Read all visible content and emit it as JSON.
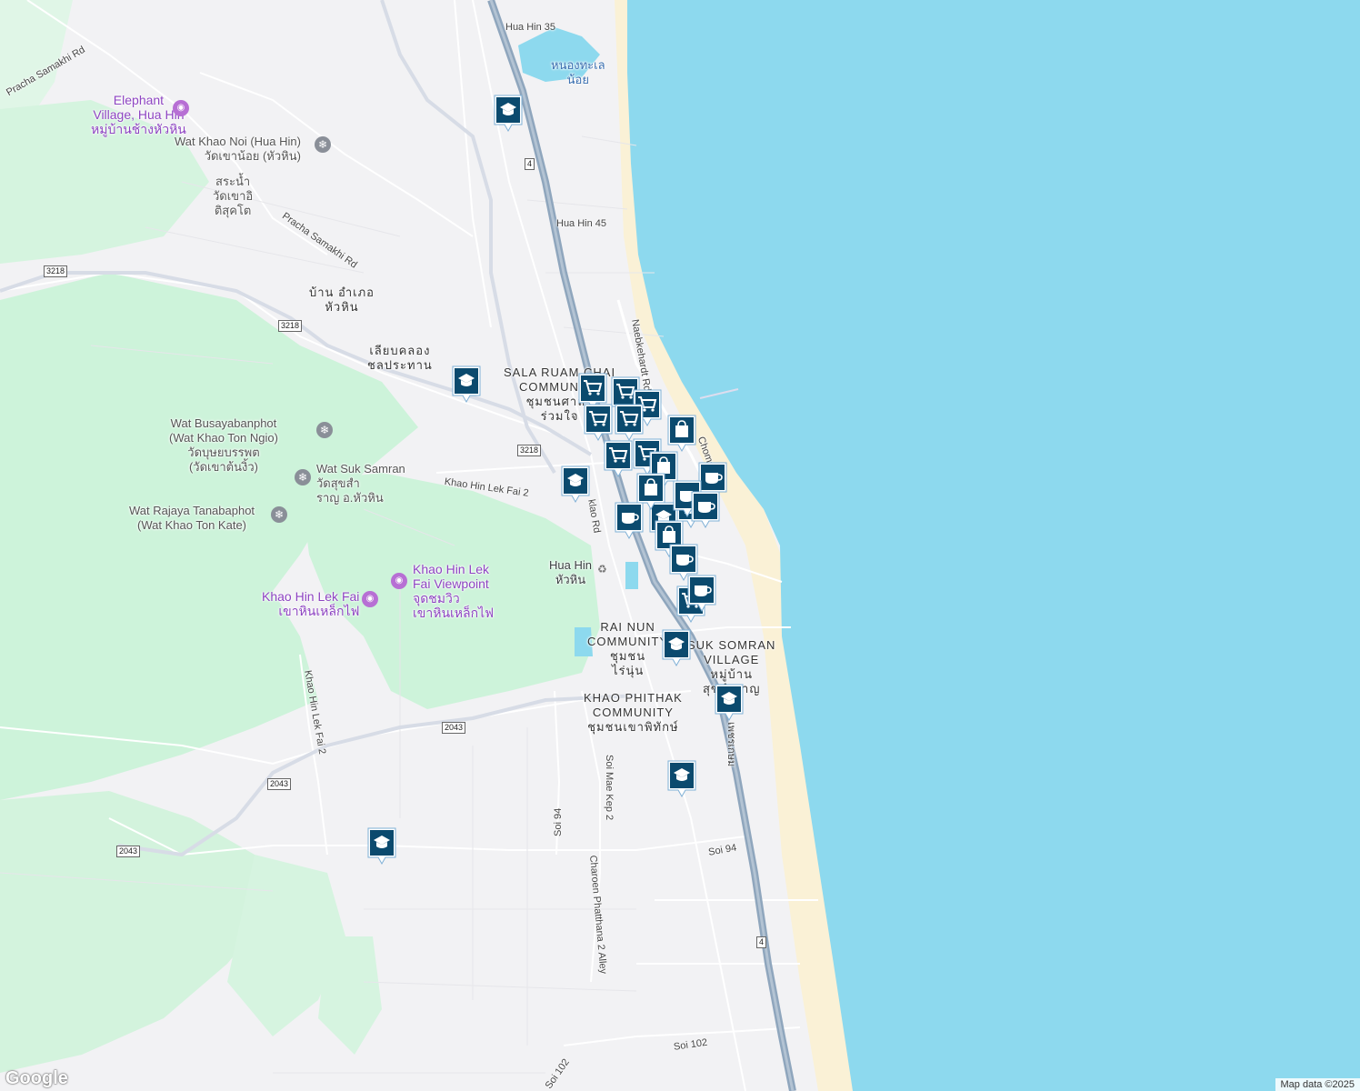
{
  "map": {
    "colors": {
      "sea": "#8dd9ee",
      "land": "#f2f2f4",
      "park": "#cdf3da",
      "park_dark": "#b7ecc8",
      "road": "#ffffff",
      "highway": "#8fa6bd",
      "beach": "#faf1d6",
      "marker": "#0b4a6e"
    },
    "road_labels": [
      {
        "id": "hua-hin-35",
        "text": "Hua Hin 35"
      },
      {
        "id": "hua-hin-45",
        "text": "Hua Hin 45"
      },
      {
        "id": "pracha-samakhi-1",
        "text": "Pracha Samakhi Rd"
      },
      {
        "id": "pracha-samakhi-2",
        "text": "Pracha Samakhi Rd"
      },
      {
        "id": "naebkehardt",
        "text": "Naebkehardt Rd"
      },
      {
        "id": "khao-hin-lek-fai-2a",
        "text": "Khao Hin Lek Fai 2"
      },
      {
        "id": "khao-hin-lek-fai-2b",
        "text": "Khao Hin Lek Fai 2"
      },
      {
        "id": "chomsin",
        "text": "Chomsin"
      },
      {
        "id": "klao-rd",
        "text": "klao Rd"
      },
      {
        "id": "soi-94a",
        "text": "Soi 94"
      },
      {
        "id": "soi-94b",
        "text": "Soi 94"
      },
      {
        "id": "soi-mae-kep-2",
        "text": "Soi Mae Kep 2"
      },
      {
        "id": "charoen",
        "text": "Charoen Phatthana 2 Alley"
      },
      {
        "id": "soi-102a",
        "text": "Soi 102"
      },
      {
        "id": "soi-102b",
        "text": "Soi 102"
      },
      {
        "id": "phetkasem",
        "text": "เพชรเกษม"
      }
    ],
    "shields": [
      {
        "id": "r4-top",
        "text": "4"
      },
      {
        "id": "r4-bottom",
        "text": "4"
      },
      {
        "id": "r3218-a",
        "text": "3218"
      },
      {
        "id": "r3218-b",
        "text": "3218"
      },
      {
        "id": "r3218-c",
        "text": "3218"
      },
      {
        "id": "r2043-a",
        "text": "2043"
      },
      {
        "id": "r2043-b",
        "text": "2043"
      },
      {
        "id": "r2043-c",
        "text": "2043"
      }
    ],
    "place_labels": [
      {
        "id": "nong-thale",
        "text": "หนองทะเล\nน้อย"
      },
      {
        "id": "elephant-village",
        "text": "Elephant\nVillage, Hua Hin\nหมู่บ้านช้างหัวหิน"
      },
      {
        "id": "wat-khao-noi",
        "text": "Wat Khao Noi (Hua Hin)\nวัดเขาน้อย (หัวหิน)"
      },
      {
        "id": "sranam",
        "text": "สระน้ำ\nวัดเขาอิ\nติสุคโต"
      },
      {
        "id": "ban-amphoe",
        "text": "บ้าน อำเภอ\nหัวหิน"
      },
      {
        "id": "liab-khlong",
        "text": "เลียบคลอง\nชลประทาน"
      },
      {
        "id": "sala-ruam-chai",
        "text": "SALA RUAM CHAI\nCOMMUNITY\nชุมชนศาลา\nร่วมใจ"
      },
      {
        "id": "wat-busaya",
        "text": "Wat Busayabanphot\n(Wat Khao Ton Ngio)\nวัดบุษยบรรพต\n(วัดเขาต้นงิ้ว)"
      },
      {
        "id": "wat-suk-samran",
        "text": "Wat Suk Samran\nวัดสุขสำ\nราญ อ.หัวหิน"
      },
      {
        "id": "wat-rajaya",
        "text": "Wat Rajaya Tanabaphot\n(Wat Khao Ton Kate)"
      },
      {
        "id": "hua-hin",
        "text": "Hua Hin\nหัวหิน"
      },
      {
        "id": "khao-hin-viewpoint",
        "text": "Khao Hin Lek\nFai Viewpoint\nจุดชมวิว\nเขาหินเหล็กไฟ"
      },
      {
        "id": "khao-hin-lek-fai",
        "text": "Khao Hin Lek Fai\nเขาหินเหล็กไฟ"
      },
      {
        "id": "rai-nun",
        "text": "RAI NUN\nCOMMUNITY\nชุมชน\nไร่นุ่น"
      },
      {
        "id": "suk-somran",
        "text": "SUK SOMRAN\nVILLAGE\nหมู่บ้าน\nสุขสำราญ"
      },
      {
        "id": "khao-phithak",
        "text": "KHAO PHITHAK\nCOMMUNITY\nชุมชนเขาพิทักษ์"
      }
    ],
    "markers": [
      {
        "type": "school"
      },
      {
        "type": "school"
      },
      {
        "type": "school"
      },
      {
        "type": "school"
      },
      {
        "type": "school"
      },
      {
        "type": "school"
      },
      {
        "type": "school"
      },
      {
        "type": "school"
      },
      {
        "type": "shopping-cart"
      },
      {
        "type": "shopping-cart"
      },
      {
        "type": "shopping-cart"
      },
      {
        "type": "shopping-cart"
      },
      {
        "type": "shopping-cart"
      },
      {
        "type": "shopping-cart"
      },
      {
        "type": "shopping-cart"
      },
      {
        "type": "shopping-cart"
      },
      {
        "type": "shopping-bag"
      },
      {
        "type": "shopping-bag"
      },
      {
        "type": "shopping-bag"
      },
      {
        "type": "shopping-bag"
      },
      {
        "type": "shopping-bag"
      },
      {
        "type": "coffee-cup"
      },
      {
        "type": "coffee-cup"
      },
      {
        "type": "coffee-cup"
      },
      {
        "type": "coffee-cup"
      },
      {
        "type": "coffee-cup"
      },
      {
        "type": "coffee-cup"
      }
    ],
    "attribution": "Map data ©2025",
    "logo": "Google"
  }
}
